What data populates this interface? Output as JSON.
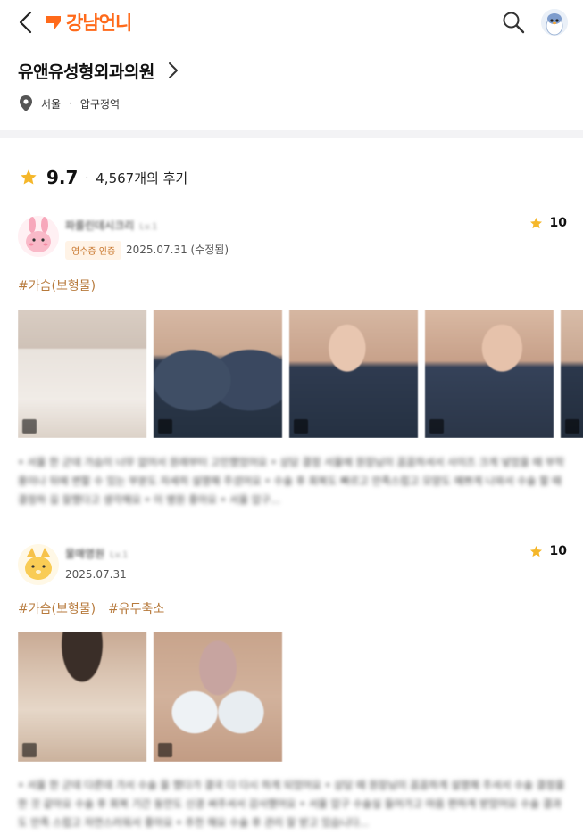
{
  "app": {
    "logo_text": "강남언니",
    "brand_color": "#ff6a1a",
    "back_icon": "chevron-left-icon",
    "search_icon": "search-icon",
    "avatar_icon": "penguin-avatar"
  },
  "clinic": {
    "name": "유앤유성형외과의원",
    "region": "서울",
    "dot": "·",
    "area": "압구정역"
  },
  "rating": {
    "score": "9.7",
    "sep": "·",
    "review_count": "4,567개의 후기"
  },
  "reviews": [
    {
      "nickname": "파를린데시크리",
      "level": "Lv.1",
      "badge": "영수증 인증",
      "date": "2025.07.31 (수정됨)",
      "score": "10",
      "tags": [
        "#가슴(보형물)"
      ],
      "photo_count": 5,
      "text": "• 서울 한 군데 가슴이 너무 없어서 원래부터 고민했었어요 • 상담 결정 서울에 원장님이 꼼꼼하셔서 사이즈 크게 넣었을 때 부작용이나 뒤에 변할 수 있는 부분도 자세히 설명해 주셨어요 • 수술 후 회복도 빠르고 만족스럽고 모양도 예쁘게 나와서 수술 할 때 결정하 길 잘했다고 생각해요 • 이 병원 좋아요 • 서울 압구..."
    },
    {
      "nickname": "물매영원",
      "level": "Lv.1",
      "date": "2025.07.31",
      "score": "10",
      "tags": [
        "#가슴(보형물)",
        "#유두축소"
      ],
      "photo_count": 2,
      "text": "• 서울 한 군데 다른데 가서 수술 을 했다가 결국 다 다시 하게 되었어요 • 상담 때 원장님이 꼼꼼하게 설명해 주셔서 수술 결정을 한 것 같아요 수술 후 회복 기간 동안도 신경 써주셔서 감사했어요 • 서울 압구 수술실 들어가고 마음 편하게 받았어요 수술 결과도 만족 스럽고 자연스러워서 좋아요 • 추천 해요 수술 후 관리 잘 받고 있습니다..."
    }
  ],
  "colors": {
    "star": "#f5b72a",
    "tag": "#b77a3c",
    "badge_bg": "#fff3e6",
    "divider": "#f3f3f5"
  }
}
